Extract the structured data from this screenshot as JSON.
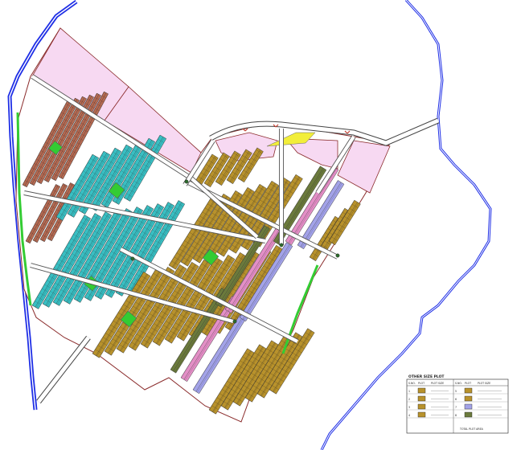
{
  "map": {
    "colors": {
      "background": "#ffffff",
      "river": "#1f2fe6",
      "boundary": "#c0392b",
      "road": "#ffffff",
      "road_edge": "#444444",
      "pink_zone": "#f7d9f2",
      "cyan_plots": "#39bfc3",
      "brown_plots": "#b8922c",
      "red_brown_plots": "#b56a52",
      "green_park": "#33cc33",
      "olive_plots": "#6b7a3c",
      "pink_plots": "#e38fc6",
      "lavender_plots": "#a3a3e8",
      "yellow_plot": "#f2ee3a"
    },
    "zones": {
      "top_left": "",
      "top_middle": "",
      "center_upper": "",
      "center_right": "",
      "far_right": ""
    },
    "legend": {
      "title": "OTHER SIZE PLOT",
      "header_row": [
        "S.NO.",
        "PLOT",
        "PLOT SIZE",
        "S.NO.",
        "PLOT",
        "PLOT SIZE"
      ],
      "rows": [
        [
          "1",
          "",
          "",
          "5",
          "",
          ""
        ],
        [
          "2",
          "",
          "",
          "6",
          "",
          ""
        ],
        [
          "3",
          "",
          "",
          "7",
          "",
          ""
        ],
        [
          "4",
          "",
          "",
          "8",
          "",
          ""
        ]
      ],
      "footer": "TOTAL PLOT AREA",
      "left_swatches": [
        "#b8922c",
        "#b8922c",
        "#b8922c",
        "#b8922c"
      ],
      "right_swatches": [
        "#b8922c",
        "#b8922c",
        "#a3a3e8",
        "#6b7a3c"
      ]
    }
  }
}
